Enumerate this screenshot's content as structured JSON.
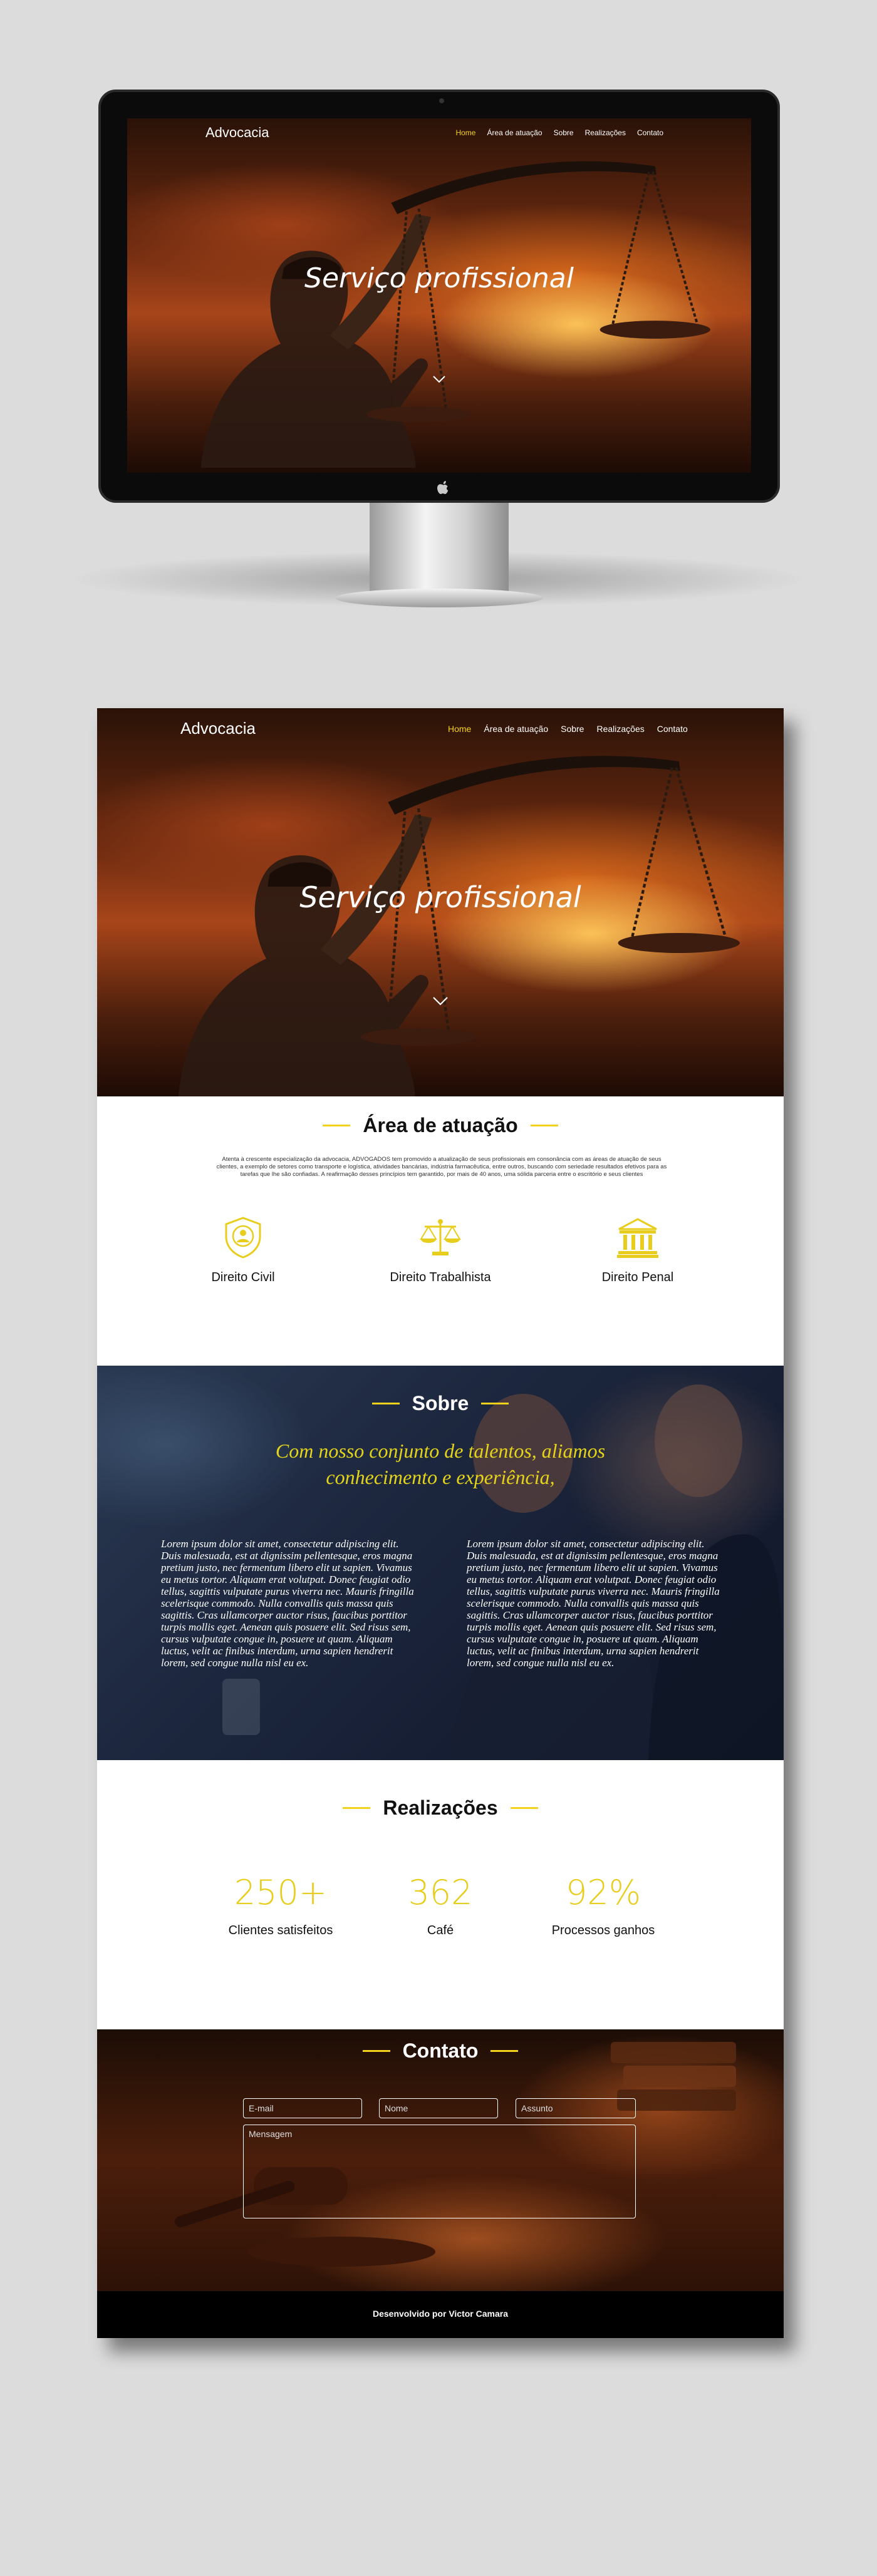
{
  "colors": {
    "accent": "#f2d21b",
    "page_bg": "#dcdcdc",
    "dark": "#000000"
  },
  "nav": {
    "brand": "Advocacia",
    "links": [
      "Home",
      "Área de atuação",
      "Sobre",
      "Realizações",
      "Contato"
    ],
    "active": "Home"
  },
  "hero": {
    "title": "Serviço profissional",
    "scroll_icon": "chevron-down-icon"
  },
  "device": {
    "logo_icon": "apple-logo-icon"
  },
  "area": {
    "title": "Área de atuação",
    "text": "Atenta à crescente especialização da advocacia, ADVOGADOS tem promovido a atualização de seus profissionais em consonância com as áreas de atuação de seus clientes, a exemplo de setores como transporte e logística, atividades bancárias, indústria farmacêutica, entre outros, buscando com seriedade resultados efetivos para as tarefas que lhe são confiadas. A reafirmação desses princípios tem garantido, por mais de 40 anos, uma sólida parceria entre o escritório e seus clientes",
    "items": [
      {
        "label": "Direito Civil",
        "icon": "shield-person-icon"
      },
      {
        "label": "Direito Trabalhista",
        "icon": "scales-icon"
      },
      {
        "label": "Direito Penal",
        "icon": "courthouse-icon"
      }
    ]
  },
  "sobre": {
    "title": "Sobre",
    "quote": "Com nosso conjunto de talentos, aliamos conhecimento e experiência,",
    "col1": "Lorem ipsum dolor sit amet, consectetur adipiscing elit. Duis malesuada, est at dignissim pellentesque, eros magna pretium justo, nec fermentum libero elit ut sapien. Vivamus eu metus tortor. Aliquam erat volutpat. Donec feugiat odio tellus, sagittis vulputate purus viverra nec. Mauris fringilla scelerisque commodo. Nulla convallis quis massa quis sagittis. Cras ullamcorper auctor risus, faucibus porttitor turpis mollis eget. Aenean quis posuere elit. Sed risus sem, cursus vulputate congue in, posuere ut quam. Aliquam luctus, velit ac finibus interdum, urna sapien hendrerit lorem, sed congue nulla nisl eu ex.",
    "col2": "Lorem ipsum dolor sit amet, consectetur adipiscing elit. Duis malesuada, est at dignissim pellentesque, eros magna pretium justo, nec fermentum libero elit ut sapien. Vivamus eu metus tortor. Aliquam erat volutpat. Donec feugiat odio tellus, sagittis vulputate purus viverra nec. Mauris fringilla scelerisque commodo. Nulla convallis quis massa quis sagittis. Cras ullamcorper auctor risus, faucibus porttitor turpis mollis eget. Aenean quis posuere elit. Sed risus sem, cursus vulputate congue in, posuere ut quam. Aliquam luctus, velit ac finibus interdum, urna sapien hendrerit lorem, sed congue nulla nisl eu ex."
  },
  "realizacoes": {
    "title": "Realizações",
    "stats": [
      {
        "value": "250+",
        "label": "Clientes satisfeitos"
      },
      {
        "value": "362",
        "label": "Café"
      },
      {
        "value": "92%",
        "label": "Processos ganhos"
      }
    ]
  },
  "contato": {
    "title": "Contato",
    "email_placeholder": "E-mail",
    "nome_placeholder": "Nome",
    "assunto_placeholder": "Assunto",
    "mensagem_placeholder": "Mensagem"
  },
  "footer": {
    "text": "Desenvolvido por Victor Camara"
  }
}
